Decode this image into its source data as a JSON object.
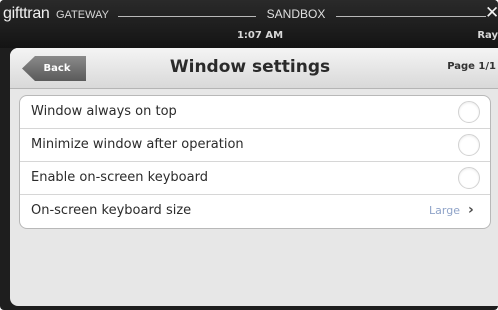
{
  "titlebar": {
    "brand": "gifttran",
    "brand_sub": "GATEWAY",
    "environment": "SANDBOX",
    "close_glyph": "✕",
    "time": "1:07 AM",
    "user": "Ray"
  },
  "header": {
    "back_label": "Back",
    "title": "Window settings",
    "page_indicator": "Page 1/1"
  },
  "settings": {
    "items": [
      {
        "label": "Window always on top",
        "control": "toggle",
        "enabled": false
      },
      {
        "label": "Minimize window after operation",
        "control": "toggle",
        "enabled": false
      },
      {
        "label": "Enable on-screen keyboard",
        "control": "toggle",
        "enabled": false
      },
      {
        "label": "On-screen keyboard size",
        "control": "select",
        "value": "Large",
        "chevron_glyph": "›"
      }
    ]
  },
  "colors": {
    "frame": "#1e1e1e",
    "panel": "#e7e7e7",
    "value_text": "#8fa3c8"
  },
  "icons": {
    "close": "close-icon",
    "chevron": "chevron-right-icon"
  }
}
